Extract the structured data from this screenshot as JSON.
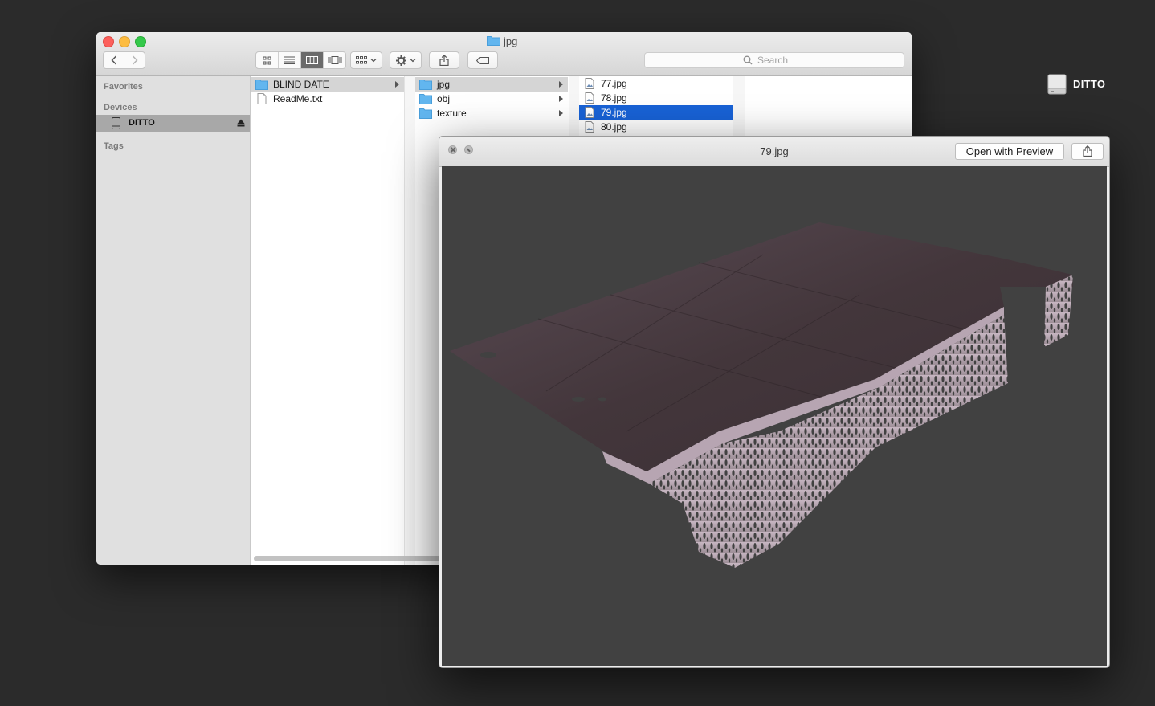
{
  "desktop": {
    "drive_label": "DITTO"
  },
  "finder": {
    "title": "jpg",
    "search_placeholder": "Search",
    "sidebar": {
      "favorites_header": "Favorites",
      "devices_header": "Devices",
      "device_name": "DITTO",
      "tags_header": "Tags"
    },
    "columns": [
      {
        "items": [
          {
            "name": "BLIND DATE",
            "type": "folder",
            "selected": true
          },
          {
            "name": "ReadMe.txt",
            "type": "file",
            "selected": false
          }
        ]
      },
      {
        "items": [
          {
            "name": "jpg",
            "type": "folder",
            "selected": true
          },
          {
            "name": "obj",
            "type": "folder",
            "selected": false
          },
          {
            "name": "texture",
            "type": "folder",
            "selected": false
          }
        ]
      },
      {
        "items": [
          {
            "name": "77.jpg",
            "type": "image",
            "selected": false
          },
          {
            "name": "78.jpg",
            "type": "image",
            "selected": false
          },
          {
            "name": "79.jpg",
            "type": "image",
            "selected": true
          },
          {
            "name": "80.jpg",
            "type": "image",
            "selected": false
          }
        ]
      }
    ],
    "active_view": "columns"
  },
  "quicklook": {
    "title": "79.jpg",
    "open_button": "Open with Preview"
  },
  "colors": {
    "selection_blue": "#1862d6",
    "desktop_bg": "#2b2b2b",
    "preview_bg": "#414141",
    "folder_blue": "#62b6ef"
  }
}
